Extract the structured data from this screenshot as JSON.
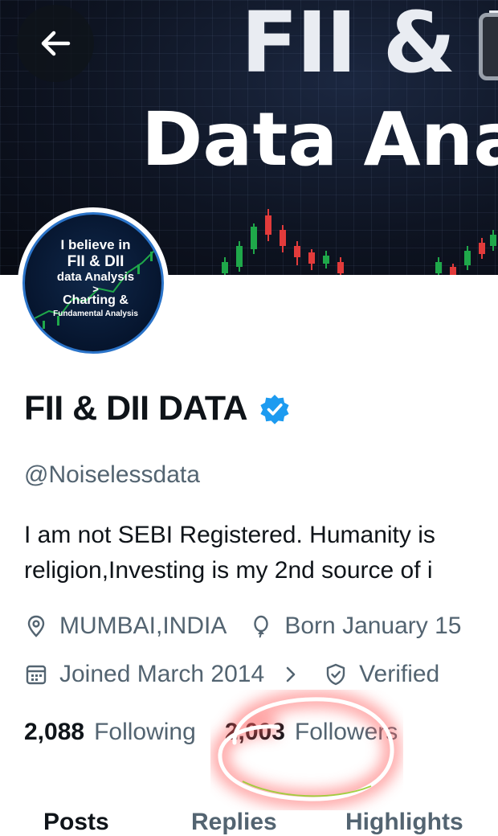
{
  "banner": {
    "line1": "FII & D",
    "line2": "Data Ana"
  },
  "avatar": {
    "line1": "I believe in",
    "line2": "FII & DII",
    "line3": "data Analysis",
    "line4": ">",
    "line5": "Charting &",
    "line6": "Fundamental Analysis"
  },
  "profile": {
    "display_name": "FII & DII DATA",
    "handle": "@Noiselessdata",
    "bio_line1": "I am not SEBI Registered. Humanity is",
    "bio_line2": "religion,Investing is my 2nd source of i",
    "location": "MUMBAI,INDIA",
    "born": "Born January 15",
    "joined": "Joined March 2014",
    "verified_label": "Verified",
    "following_count": "2,088",
    "following_label": "Following",
    "followers_count": "2,003",
    "followers_label": "Followers"
  },
  "tabs": [
    {
      "label": "Posts",
      "active": true
    },
    {
      "label": "Replies",
      "active": false
    },
    {
      "label": "Highlights",
      "active": false
    }
  ],
  "colors": {
    "accent": "#1d9bf0",
    "text_primary": "#0f1419",
    "text_secondary": "#536471",
    "annotation_highlight": "#ff5a5a"
  },
  "icons": [
    "back-arrow-icon",
    "verified-badge-icon",
    "location-pin-icon",
    "balloon-icon",
    "calendar-icon",
    "chevron-right-icon",
    "shield-check-icon"
  ]
}
